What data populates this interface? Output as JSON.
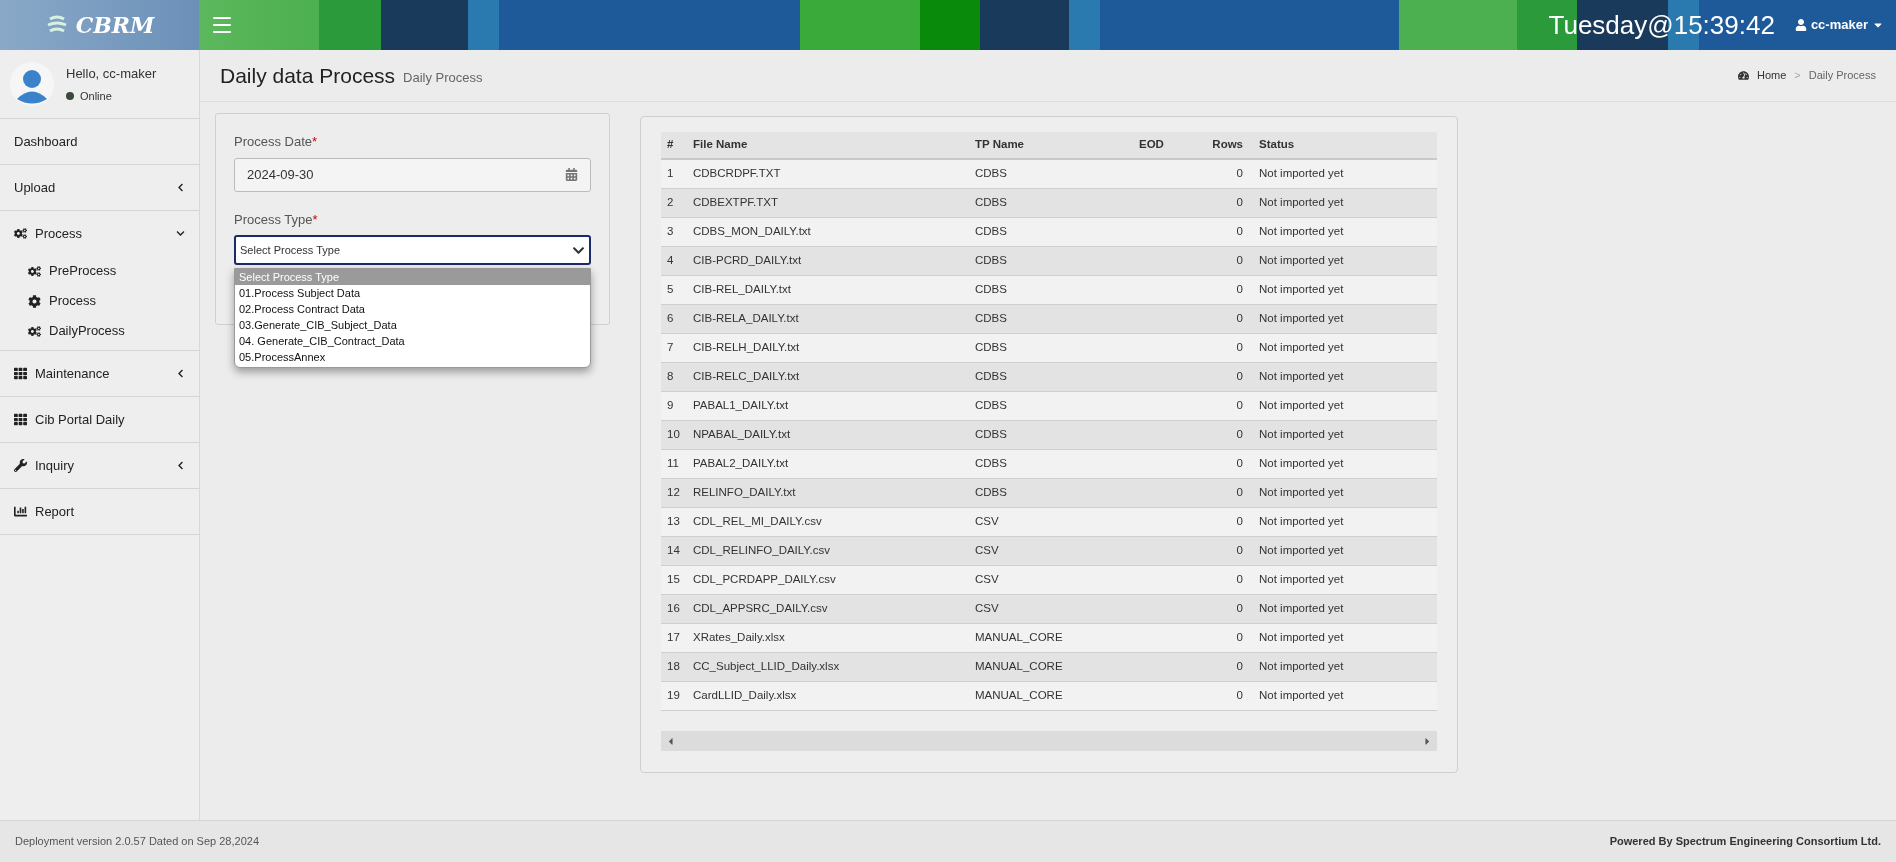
{
  "header": {
    "logo": "CBRM",
    "clock": "Tuesday@15:39:42",
    "user": "cc-maker"
  },
  "sidebar": {
    "user": {
      "greeting": "Hello, cc-maker",
      "status": "Online",
      "online": true
    },
    "items": [
      {
        "label": "Dashboard",
        "kind": "link"
      },
      {
        "label": "Upload",
        "kind": "submenu",
        "expanded": false
      },
      {
        "label": "Process",
        "kind": "submenu",
        "expanded": true,
        "children": [
          {
            "label": "PreProcess"
          },
          {
            "label": "Process"
          },
          {
            "label": "DailyProcess"
          }
        ]
      },
      {
        "label": "Maintenance",
        "kind": "submenu",
        "expanded": false
      },
      {
        "label": "Cib Portal Daily",
        "kind": "link"
      },
      {
        "label": "Inquiry",
        "kind": "submenu",
        "expanded": false
      },
      {
        "label": "Report",
        "kind": "link"
      }
    ]
  },
  "page": {
    "title": "Daily data Process",
    "subtitle": "Daily Process",
    "breadcrumb": {
      "separator": ">",
      "items": [
        "Home",
        "Daily Process"
      ]
    }
  },
  "form": {
    "date": {
      "label": "Process Date",
      "required": "*",
      "value": "2024-09-30"
    },
    "type": {
      "label": "Process Type",
      "required": "*",
      "value": "Select Process Type",
      "options": [
        {
          "label": "Select Process Type",
          "selected": true
        },
        {
          "label": "01.Process Subject Data",
          "selected": false
        },
        {
          "label": "02.Process Contract Data",
          "selected": false
        },
        {
          "label": "03.Generate_CIB_Subject_Data",
          "selected": false
        },
        {
          "label": "04. Generate_CIB_Contract_Data",
          "selected": false
        },
        {
          "label": "05.ProcessAnnex",
          "selected": false
        }
      ]
    }
  },
  "table": {
    "columns": [
      "#",
      "File Name",
      "TP Name",
      "EOD",
      "Rows",
      "Status"
    ],
    "rows": [
      [
        "1",
        "CDBCRDPF.TXT",
        "CDBS",
        "",
        "0",
        "Not imported yet"
      ],
      [
        "2",
        "CDBEXTPF.TXT",
        "CDBS",
        "",
        "0",
        "Not imported yet"
      ],
      [
        "3",
        "CDBS_MON_DAILY.txt",
        "CDBS",
        "",
        "0",
        "Not imported yet"
      ],
      [
        "4",
        "CIB-PCRD_DAILY.txt",
        "CDBS",
        "",
        "0",
        "Not imported yet"
      ],
      [
        "5",
        "CIB-REL_DAILY.txt",
        "CDBS",
        "",
        "0",
        "Not imported yet"
      ],
      [
        "6",
        "CIB-RELA_DAILY.txt",
        "CDBS",
        "",
        "0",
        "Not imported yet"
      ],
      [
        "7",
        "CIB-RELH_DAILY.txt",
        "CDBS",
        "",
        "0",
        "Not imported yet"
      ],
      [
        "8",
        "CIB-RELC_DAILY.txt",
        "CDBS",
        "",
        "0",
        "Not imported yet"
      ],
      [
        "9",
        "PABAL1_DAILY.txt",
        "CDBS",
        "",
        "0",
        "Not imported yet"
      ],
      [
        "10",
        "NPABAL_DAILY.txt",
        "CDBS",
        "",
        "0",
        "Not imported yet"
      ],
      [
        "11",
        "PABAL2_DAILY.txt",
        "CDBS",
        "",
        "0",
        "Not imported yet"
      ],
      [
        "12",
        "RELINFO_DAILY.txt",
        "CDBS",
        "",
        "0",
        "Not imported yet"
      ],
      [
        "13",
        "CDL_REL_MI_DAILY.csv",
        "CSV",
        "",
        "0",
        "Not imported yet"
      ],
      [
        "14",
        "CDL_RELINFO_DAILY.csv",
        "CSV",
        "",
        "0",
        "Not imported yet"
      ],
      [
        "15",
        "CDL_PCRDAPP_DAILY.csv",
        "CSV",
        "",
        "0",
        "Not imported yet"
      ],
      [
        "16",
        "CDL_APPSRC_DAILY.csv",
        "CSV",
        "",
        "0",
        "Not imported yet"
      ],
      [
        "17",
        "XRates_Daily.xlsx",
        "MANUAL_CORE",
        "",
        "0",
        "Not imported yet"
      ],
      [
        "18",
        "CC_Subject_LLID_Daily.xlsx",
        "MANUAL_CORE",
        "",
        "0",
        "Not imported yet"
      ],
      [
        "19",
        "CardLLID_Daily.xlsx",
        "MANUAL_CORE",
        "",
        "0",
        "Not imported yet"
      ]
    ]
  },
  "footer": {
    "left": "Deployment version 2.0.57 Dated on Sep 28,2024",
    "right": "Powered By Spectrum Engineering Consortium Ltd."
  }
}
